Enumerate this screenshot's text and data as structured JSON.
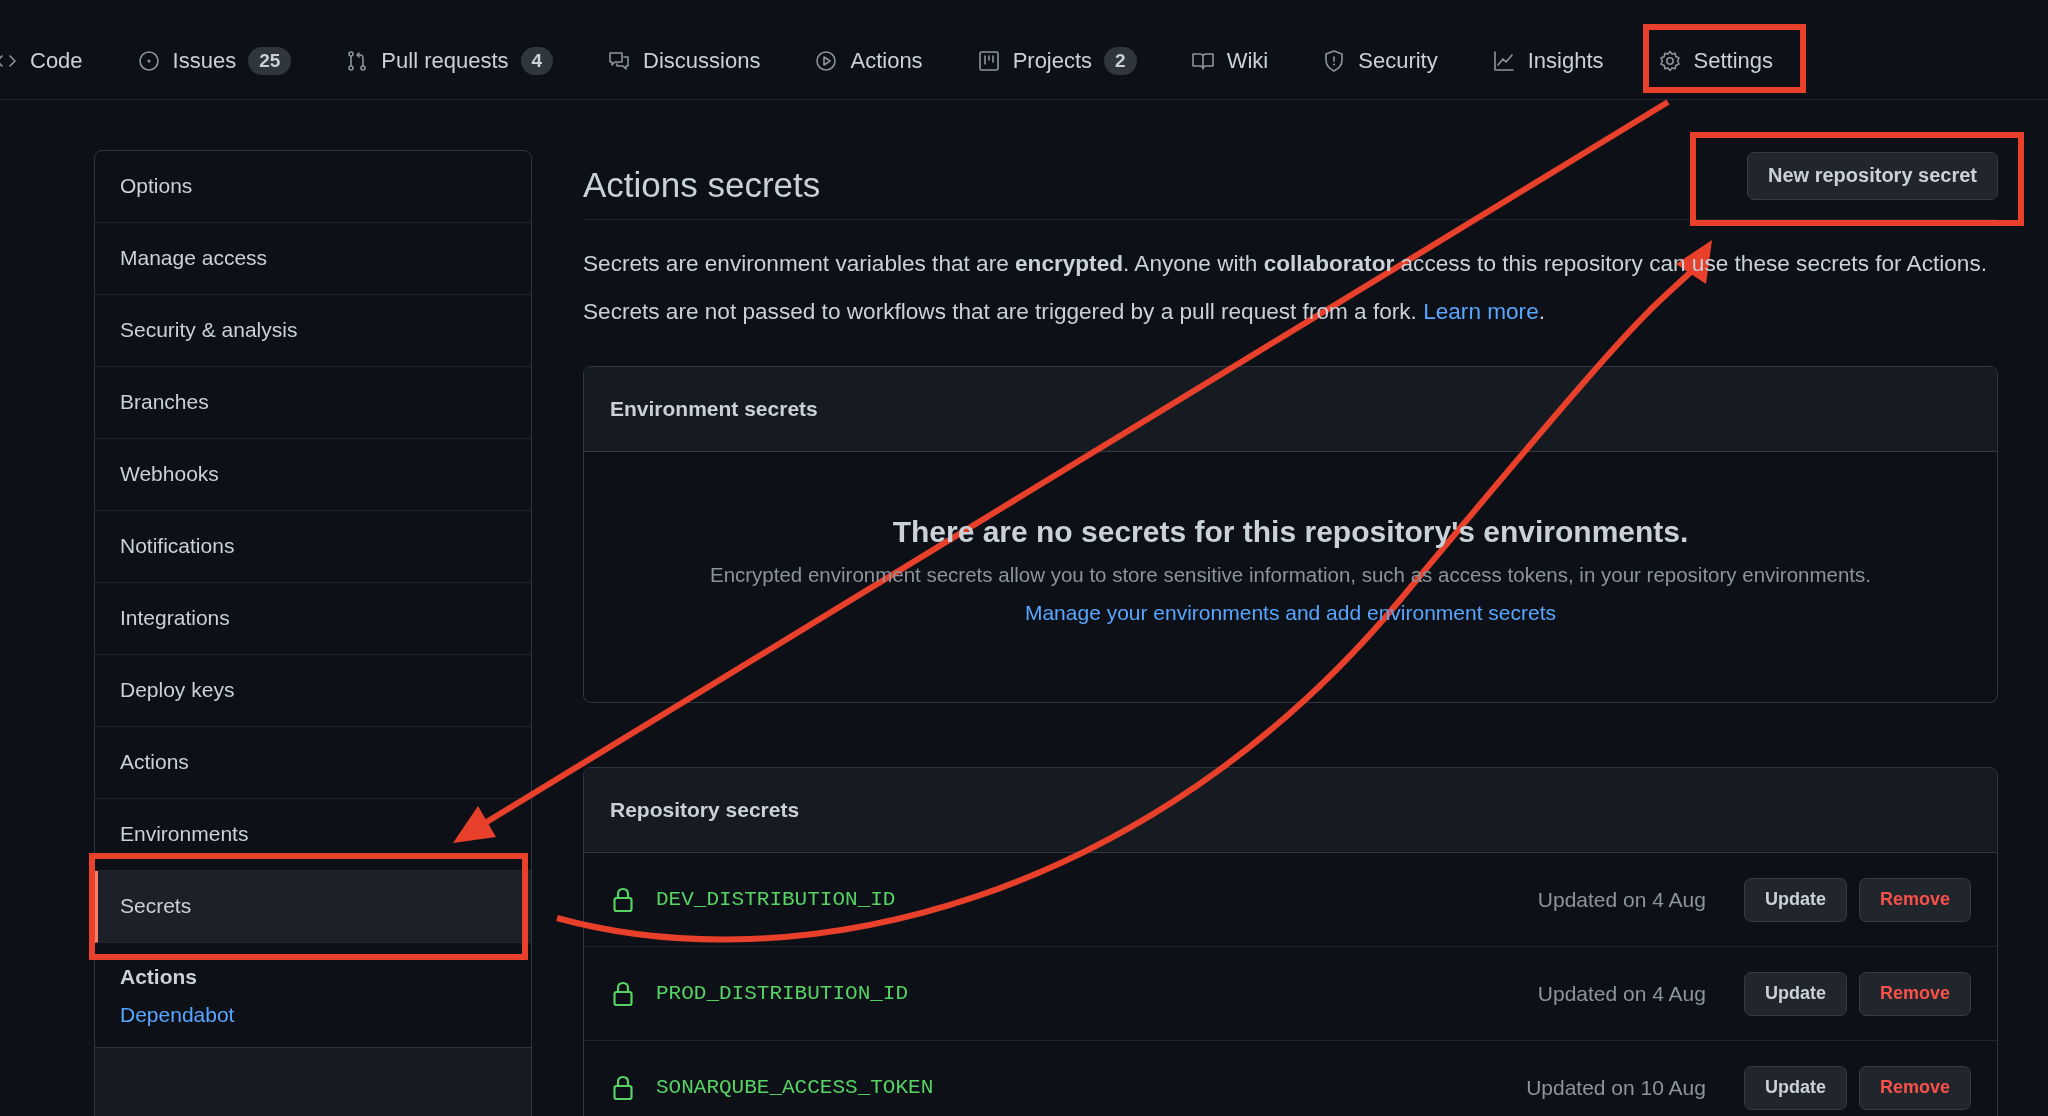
{
  "nav": {
    "tabs": [
      {
        "label": "Code"
      },
      {
        "label": "Issues",
        "count": "25"
      },
      {
        "label": "Pull requests",
        "count": "4"
      },
      {
        "label": "Discussions"
      },
      {
        "label": "Actions"
      },
      {
        "label": "Projects",
        "count": "2"
      },
      {
        "label": "Wiki"
      },
      {
        "label": "Security"
      },
      {
        "label": "Insights"
      },
      {
        "label": "Settings"
      }
    ]
  },
  "sidebar": {
    "items": [
      {
        "label": "Options",
        "selected": false
      },
      {
        "label": "Manage access",
        "selected": false
      },
      {
        "label": "Security & analysis",
        "selected": false
      },
      {
        "label": "Branches",
        "selected": false
      },
      {
        "label": "Webhooks",
        "selected": false
      },
      {
        "label": "Notifications",
        "selected": false
      },
      {
        "label": "Integrations",
        "selected": false
      },
      {
        "label": "Deploy keys",
        "selected": false
      },
      {
        "label": "Actions",
        "selected": false
      },
      {
        "label": "Environments",
        "selected": false
      },
      {
        "label": "Secrets",
        "selected": true
      }
    ],
    "section_title": "Actions",
    "section_links": [
      "Dependabot"
    ]
  },
  "main": {
    "title": "Actions secrets",
    "new_button": "New repository secret",
    "description": "Secrets are environment variables that are **encrypted**. Anyone with **collaborator** access to this repository can use these secrets for Actions.",
    "note": "Secrets are not passed to workflows that are triggered by a pull request from a fork.",
    "note_link": "Learn more",
    "note_end": ".",
    "environment": {
      "title": "Environment secrets",
      "empty_title": "There are no secrets for this repository's environments.",
      "empty_text": "Encrypted environment secrets allow you to store sensitive information, such as access tokens, in your repository environments.",
      "link": "Manage your environments and add environment secrets"
    },
    "repository": {
      "title": "Repository secrets",
      "secrets": [
        {
          "name": "DEV_DISTRIBUTION_ID",
          "updated": "Updated on 4 Aug",
          "update_label": "Update",
          "remove_label": "Remove"
        },
        {
          "name": "PROD_DISTRIBUTION_ID",
          "updated": "Updated on 4 Aug",
          "update_label": "Update",
          "remove_label": "Remove"
        },
        {
          "name": "SONARQUBE_ACCESS_TOKEN",
          "updated": "Updated on 10 Aug",
          "update_label": "Update",
          "remove_label": "Remove"
        }
      ]
    }
  }
}
